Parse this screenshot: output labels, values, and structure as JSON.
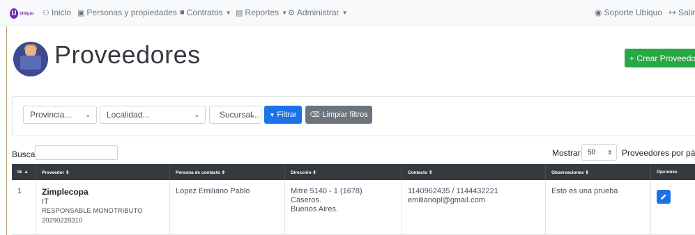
{
  "navbar": {
    "logo_letter": "U",
    "logo_text": "bitiquo",
    "items": [
      {
        "label": "Inicio",
        "icon": "dashboard-icon",
        "glyph": "⚇"
      },
      {
        "label": "Personas y propiedades",
        "icon": "id-card-icon",
        "glyph": "▣",
        "caret": "▼"
      },
      {
        "label": "Contratos",
        "icon": "contract-icon",
        "glyph": "■",
        "caret": "▼"
      },
      {
        "label": "Reportes",
        "icon": "report-icon",
        "glyph": "▤",
        "caret": "▼"
      },
      {
        "label": "Administrar",
        "icon": "gear-icon",
        "glyph": "⚙",
        "caret": "▼"
      }
    ],
    "support": {
      "label": "Soporte Ubiquo",
      "glyph": "◉"
    },
    "logout": {
      "label": "Salir",
      "glyph": "↦"
    }
  },
  "page": {
    "title": "Proveedores",
    "create_button": "+ Crear Proveedor"
  },
  "filters": {
    "provincia": "Provincia...",
    "localidad": "Localidad...",
    "sucursal": "Sucursal...",
    "chevron": "⌄",
    "filter_button": "Filtrar",
    "filter_glyph": "▼",
    "clear_button": "Limpiar filtros",
    "clear_glyph": "⌫"
  },
  "search": {
    "label": "Buscar",
    "value": ""
  },
  "page_size": {
    "label_before": "Mostrar",
    "value": "50",
    "arrows": "⇕",
    "label_after": "Proveedores por página"
  },
  "table": {
    "headers": [
      "Id. ▲",
      "Proveedor ⇕",
      "Persona de contacto ⇕",
      "Dirección ⇕",
      "Contacto ⇕",
      "Observaciones ⇕",
      "Opciones"
    ],
    "rows": [
      {
        "id": "1",
        "name": "Zimplecopa",
        "category": "IT",
        "tax_condition": "RESPONSABLE MONOTRIBUTO",
        "cuit": "20290228310",
        "contact_person": "Lopez Emiliano Pablo",
        "address_1": "Mitre 5140 - 1 (1678)",
        "address_2": "Caseros.",
        "address_3": "Buenos Aires.",
        "phones": "1140962435 / 1144432221",
        "email": "emilianopl@gmail.com",
        "notes": "Esto es una prueba"
      }
    ]
  },
  "colors": {
    "navbar_bg": "#f8f9fa",
    "primary": "#1a73e8",
    "success": "#28a745",
    "secondary": "#6c757d",
    "table_header": "#343a40"
  }
}
